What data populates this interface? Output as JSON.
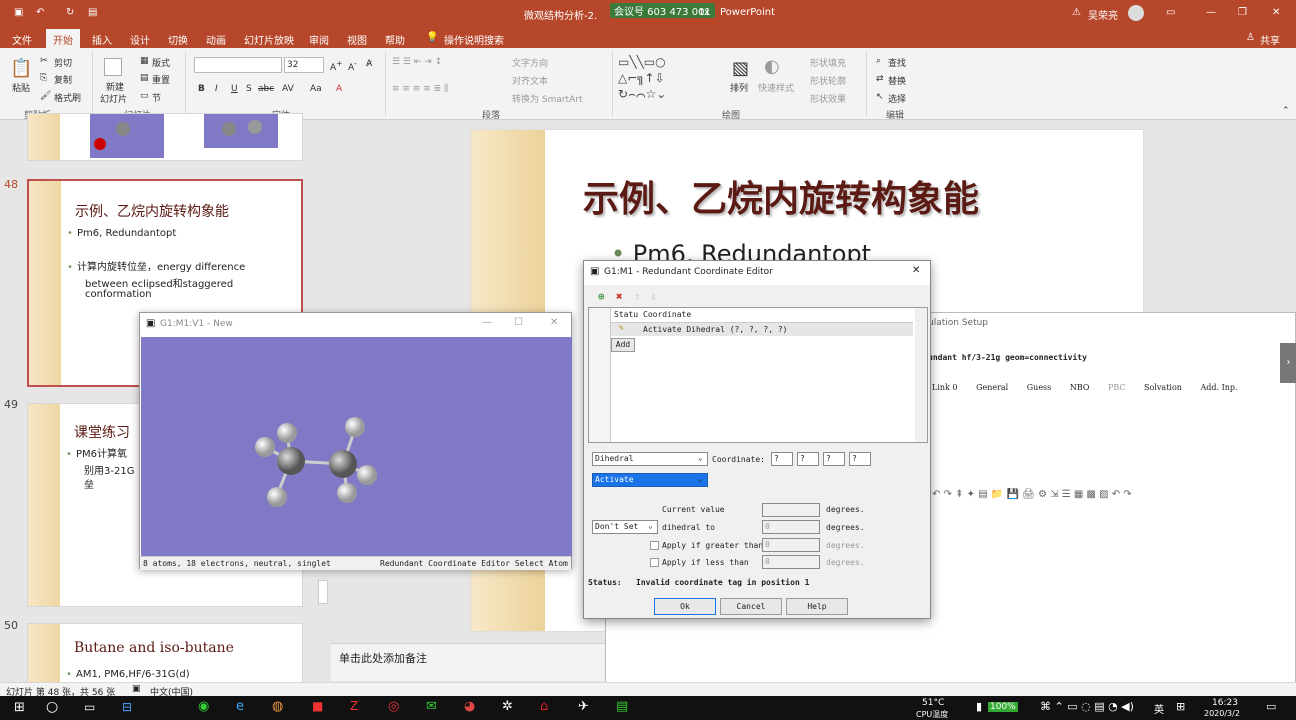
{
  "window": {
    "app_name": "PowerPoint",
    "file_name": "微观结构分析-2.",
    "file_ext": "tx",
    "meeting_id": "会议号 603 473 001",
    "user": "吴荣亮"
  },
  "ribbon_tabs": [
    "文件",
    "开始",
    "插入",
    "设计",
    "切换",
    "动画",
    "幻灯片放映",
    "审阅",
    "视图",
    "帮助",
    "操作说明搜索"
  ],
  "share_label": "共享",
  "ribbon": {
    "clipboard": {
      "paste": "粘贴",
      "cut": "剪切",
      "copy": "复制",
      "format_painter": "格式刷",
      "group": "剪贴板"
    },
    "slides": {
      "new_slide": "新建",
      "new_slide2": "幻灯片",
      "layout": "版式",
      "reset": "重置",
      "section": "节",
      "group": "幻灯片"
    },
    "font": {
      "size": "32",
      "group": "字体",
      "bold": "B",
      "italic": "I",
      "underline": "U",
      "strike": "S",
      "shadow": "abc",
      "spacing": "AV",
      "case": "Aa",
      "color": "A"
    },
    "paragraph": {
      "text_dir": "文字方向",
      "align_text": "对齐文本",
      "smartart": "转换为 SmartArt",
      "group": "段落"
    },
    "drawing": {
      "arrange": "排列",
      "quick_styles": "快速样式",
      "fill": "形状填充",
      "outline": "形状轮廓",
      "effects": "形状效果",
      "group": "绘图"
    },
    "editing": {
      "find": "查找",
      "replace": "替换",
      "select": "选择",
      "group": "编辑"
    }
  },
  "thumbnails": [
    {
      "num": "48",
      "title": "示例、乙烷内旋转构象能",
      "bullets": [
        "Pm6, Redundantopt",
        "计算内旋转位垒，energy difference",
        "between eclipsed和staggered",
        "conformation"
      ]
    },
    {
      "num": "49",
      "title": "课堂练习",
      "bullets": [
        "PM6计算氧",
        "别用3-21G",
        "垒"
      ]
    },
    {
      "num": "50",
      "title": "Butane and iso-butane",
      "bullets": [
        "AM1, PM6,HF/6-31G(d)"
      ]
    }
  ],
  "main_slide": {
    "title": "示例、乙烷内旋转构象能",
    "bullet": "Pm6, Redundantopt"
  },
  "notes_placeholder": "单击此处添加备注",
  "status": {
    "slide_info": "幻灯片 第 48 张，共 56 张",
    "language": "中文(中国)"
  },
  "mol_window": {
    "title": "G1:M1:V1 - New",
    "status_left": "8 atoms, 18 electrons, neutral, singlet",
    "status_right": "Redundant Coordinate Editor Select Atom"
  },
  "calc_setup": {
    "title": "ulation Setup",
    "route": "undant hf/3-21g geom=connectivity",
    "tabs": [
      "Link 0",
      "General",
      "Guess",
      "NBO",
      "PBC",
      "Solvation",
      "Add. Inp."
    ]
  },
  "editor": {
    "title": "G1:M1 - Redundant Coordinate Editor",
    "col_status": "Statu",
    "col_coord": "Coordinate",
    "row1": "Activate Dihedral (?, ?, ?, ?)",
    "add": "Add",
    "type": "Dihedral",
    "coord_label": "Coordinate:",
    "coord_vals": [
      "?",
      "?",
      "?",
      "?"
    ],
    "action": "Activate",
    "current_value": "Current value",
    "dont_set": "Don't Set",
    "dihedral_to": "dihedral to",
    "greater": "Apply if greater than",
    "less": "Apply if less than",
    "zero": "0",
    "degrees": "degrees.",
    "status_label": "Status:",
    "status_msg": "Invalid coordinate tag in position 1",
    "ok": "Ok",
    "cancel": "Cancel",
    "help": "Help"
  },
  "taskbar": {
    "temp": "51°C",
    "cpu": "CPU温度",
    "battery": "100%",
    "ime": "英",
    "time": "16:23",
    "date": "2020/3/2"
  }
}
